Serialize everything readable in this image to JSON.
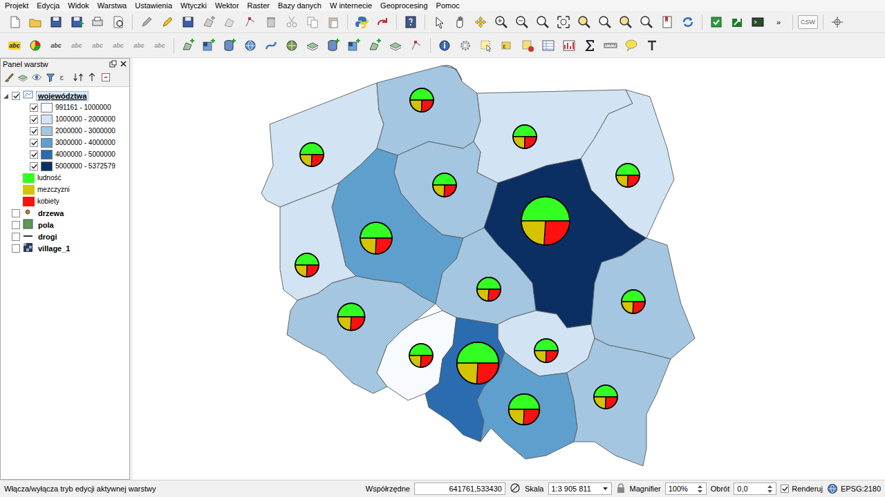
{
  "menu": [
    "Projekt",
    "Edycja",
    "Widok",
    "Warstwa",
    "Ustawienia",
    "Wtyczki",
    "Wektor",
    "Raster",
    "Bazy danych",
    "W internecie",
    "Geoprocesing",
    "Pomoc"
  ],
  "toolbar": {
    "more": "»",
    "csw": "CSW",
    "label_tools": [
      {
        "label": "abc",
        "disabled": false
      },
      {
        "label": "abc",
        "disabled": false
      },
      {
        "label": "abc",
        "disabled": true
      },
      {
        "label": "abc",
        "disabled": true
      },
      {
        "label": "abc",
        "disabled": true
      },
      {
        "label": "abc",
        "disabled": true
      },
      {
        "label": "abc",
        "disabled": true
      }
    ]
  },
  "layers_panel": {
    "title": "Panel warstw",
    "layers": [
      {
        "name": "województwa",
        "kind": "polygon",
        "checked": true,
        "expanded": true,
        "selected": true,
        "legend": [
          {
            "label": "991161 - 1000000",
            "kind": "class",
            "checked": true,
            "color": "#f7fbff"
          },
          {
            "label": "1000000 - 2000000",
            "kind": "class",
            "checked": true,
            "color": "#d2e3f3"
          },
          {
            "label": "2000000 - 3000000",
            "kind": "class",
            "checked": true,
            "color": "#a4c6e0"
          },
          {
            "label": "3000000 - 4000000",
            "kind": "class",
            "checked": true,
            "color": "#5e9fce"
          },
          {
            "label": "4000000 - 5000000",
            "kind": "class",
            "checked": true,
            "color": "#2b6cb0"
          },
          {
            "label": "5000000 - 5372579",
            "kind": "class",
            "checked": true,
            "color": "#0c2f63"
          },
          {
            "label": "ludność",
            "kind": "diagram",
            "color": "#33ff22"
          },
          {
            "label": "mezczyzni",
            "kind": "diagram",
            "color": "#d4c400"
          },
          {
            "label": "kobiety",
            "kind": "diagram",
            "color": "#ff1010"
          }
        ]
      },
      {
        "name": "drzewa",
        "kind": "point",
        "checked": false,
        "expanded": false,
        "selected": false,
        "legend": []
      },
      {
        "name": "pola",
        "kind": "fill",
        "checked": false,
        "expanded": false,
        "selected": false,
        "legend": []
      },
      {
        "name": "drogi",
        "kind": "line",
        "checked": false,
        "expanded": false,
        "selected": false,
        "legend": []
      },
      {
        "name": "village_1",
        "kind": "raster",
        "checked": false,
        "expanded": false,
        "selected": false,
        "legend": []
      }
    ]
  },
  "map": {
    "regions": [
      {
        "color": "#d2e3f3",
        "values": [
          1722883,
          838000,
          884883
        ]
      },
      {
        "color": "#a4c6e0",
        "values": [
          2290070,
          1120000,
          1170070
        ]
      },
      {
        "color": "#d2e3f3",
        "values": [
          1446915,
          708000,
          738915
        ]
      },
      {
        "color": "#d2e3f3",
        "values": [
          1200982,
          586000,
          614982
        ]
      },
      {
        "color": "#a4c6e0",
        "values": [
          2098370,
          1019000,
          1079370
        ]
      },
      {
        "color": "#5e9fce",
        "values": [
          3455477,
          1681000,
          1774477
        ]
      },
      {
        "color": "#0c2f63",
        "values": [
          5372579,
          2574000,
          2798579
        ]
      },
      {
        "color": "#d2e3f3",
        "values": [
          1023158,
          499000,
          524158
        ]
      },
      {
        "color": "#a4c6e0",
        "values": [
          2533681,
          1208000,
          1325681
        ]
      },
      {
        "color": "#a4c6e0",
        "values": [
          2172766,
          1054000,
          1118766
        ]
      },
      {
        "color": "#a4c6e0",
        "values": [
          2914362,
          1404000,
          1510362
        ]
      },
      {
        "color": "#f7fbff",
        "values": [
          991161,
          478000,
          513161
        ]
      },
      {
        "color": "#d2e3f3",
        "values": [
          1268239,
          619000,
          649239
        ]
      },
      {
        "color": "#2b6cb0",
        "values": [
          4615870,
          2231000,
          2384870
        ]
      },
      {
        "color": "#5e9fce",
        "values": [
          3360581,
          1635000,
          1725581
        ]
      },
      {
        "color": "#a4c6e0",
        "values": [
          2129951,
          1047000,
          1082951
        ]
      }
    ]
  },
  "status_bar": {
    "message": "Włącza/wyłącza tryb edycji aktywnej warstwy",
    "coords_label": "Współrzędne",
    "coords": "641761,533430",
    "scale_label": "Skala",
    "scale": "1:3 905 811",
    "magnifier_label": "Magnifier",
    "magnifier": "100%",
    "rotation_label": "Obrót",
    "rotation": "0,0",
    "render_label": "Renderuj",
    "render": true,
    "crs": "EPSG:2180"
  }
}
